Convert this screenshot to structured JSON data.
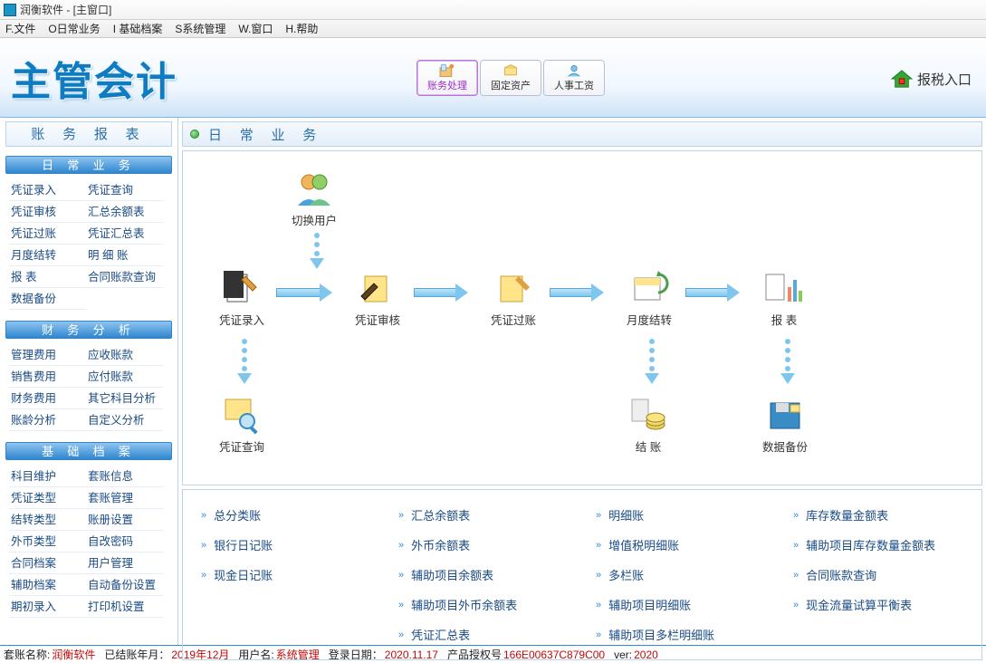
{
  "window": {
    "title": "润衡软件 - [主窗口]"
  },
  "menu": [
    "F.文件",
    "O日常业务",
    "I 基础档案",
    "S系统管理",
    "W.窗口",
    "H.帮助"
  ],
  "banner": {
    "logo_text": "主管会计",
    "tabs": [
      {
        "label": "账务处理",
        "active": true
      },
      {
        "label": "固定资产",
        "active": false
      },
      {
        "label": "人事工资",
        "active": false
      }
    ],
    "tax_entry": "报税入口"
  },
  "sidebar": {
    "title": "账 务 报 表",
    "groups": [
      {
        "header": "日 常 业 务",
        "rows": [
          [
            "凭证录入",
            "凭证查询"
          ],
          [
            "凭证审核",
            "汇总余额表"
          ],
          [
            "凭证过账",
            "凭证汇总表"
          ],
          [
            "月度结转",
            "明 细 账"
          ],
          [
            "报   表",
            "合同账款查询"
          ],
          [
            "数据备份",
            ""
          ]
        ]
      },
      {
        "header": "财 务 分 析",
        "rows": [
          [
            "管理费用",
            "应收账款"
          ],
          [
            "销售费用",
            "应付账款"
          ],
          [
            "财务费用",
            "其它科目分析"
          ],
          [
            "账龄分析",
            "自定义分析"
          ]
        ]
      },
      {
        "header": "基 础 档 案",
        "rows": [
          [
            "科目维护",
            "套账信息"
          ],
          [
            "凭证类型",
            "套账管理"
          ],
          [
            "结转类型",
            "账册设置"
          ],
          [
            "外币类型",
            "自改密码"
          ],
          [
            "合同档案",
            "用户管理"
          ],
          [
            "辅助档案",
            "自动备份设置"
          ],
          [
            "期初录入",
            "打印机设置"
          ]
        ]
      }
    ]
  },
  "workspace": {
    "header": "日 常 业 务",
    "nodes": {
      "switch_user": "切换用户",
      "entry": "凭证录入",
      "audit": "凭证审核",
      "post": "凭证过账",
      "month_end": "月度结转",
      "report": "报  表",
      "query": "凭证查询",
      "closing": "结  账",
      "backup": "数据备份"
    },
    "link_columns": [
      [
        "总分类账",
        "银行日记账",
        "现金日记账"
      ],
      [
        "汇总余额表",
        "外币余额表",
        "辅助项目余额表",
        "辅助项目外币余额表",
        "凭证汇总表"
      ],
      [
        "明细账",
        "增值税明细账",
        "多栏账",
        "辅助项目明细账",
        "辅助项目多栏明细账"
      ],
      [
        "库存数量金额表",
        "辅助项目库存数量金额表",
        "合同账款查询",
        "现金流量试算平衡表"
      ]
    ]
  },
  "status": {
    "acct_label": "套账名称:",
    "acct": "润衡软件",
    "closed_label": "已结账年月：",
    "closed": "2019年12月",
    "user_label": "用户名:",
    "user": "系统管理",
    "login_label": "登录日期：",
    "login": "2020.11.17",
    "lic_label": "产品授权号",
    "lic": "166E00637C879C00",
    "ver_label": "ver:",
    "ver": "2020"
  }
}
